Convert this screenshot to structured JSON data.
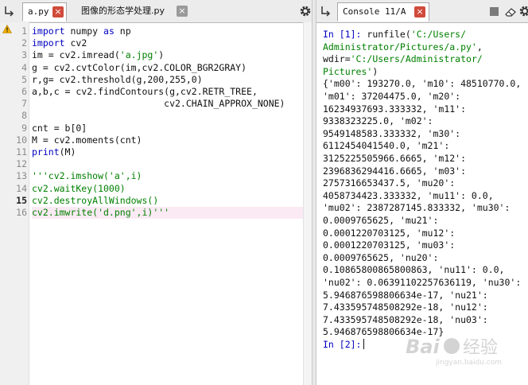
{
  "editor": {
    "tabs": [
      {
        "label": "a.py",
        "close": "×"
      },
      {
        "label": "图像的形态学处理.py",
        "close": "×"
      }
    ],
    "line_numbers": [
      "1",
      "2",
      "3",
      "4",
      "5",
      "6",
      "7",
      "8",
      "9",
      "10",
      "11",
      "12",
      "13",
      "14",
      "15",
      "16"
    ],
    "current_line": 15,
    "code": {
      "l1a": "import",
      "l1b": " numpy ",
      "l1c": "as",
      "l1d": " np",
      "l2a": "import",
      "l2b": " cv2",
      "l3a": "im = cv2.imread(",
      "l3b": "'a.jpg'",
      "l3c": ")",
      "l4": "g = cv2.cvtColor(im,cv2.COLOR_BGR2GRAY)",
      "l5": "r,g= cv2.threshold(g,200,255,0)",
      "l6": "a,b,c = cv2.findContours(g,cv2.RETR_TREE,",
      "l7": "                        cv2.CHAIN_APPROX_NONE)",
      "l9": "cnt = b[0]",
      "l10": "M = cv2.moments(cnt)",
      "l11a": "print",
      "l11b": "(M)",
      "l13": "'''cv2.imshow('a',i)",
      "l14": "cv2.waitKey(1000)",
      "l15": "cv2.destroyAllWindows()",
      "l16": "cv2.imwrite('d.png',i)'''"
    }
  },
  "console": {
    "tab_label": "Console 11/A",
    "close": "×",
    "in1_prompt": "In [1]:",
    "in1_cmd": " runfile(",
    "in1_path1": "'C:/Users/",
    "in1_path2": "Administrator/Pictures/a.py'",
    "in1_sep": ",",
    "in1_wdir_key": "wdir=",
    "in1_wdir1": "'C:/Users/Administrator/",
    "in1_wdir2": "Pictures'",
    "in1_end": ")",
    "output": [
      "{'m00': 193270.0, 'm10': 48510770.0,",
      "'m01': 37204475.0, 'm20':",
      "16234937693.333332, 'm11':",
      "9338323225.0, 'm02':",
      "9549148583.333332, 'm30':",
      "6112454041540.0, 'm21':",
      "3125225505966.6665, 'm12':",
      "2396836294416.6665, 'm03':",
      "2757316653437.5, 'mu20':",
      "4058734423.333332, 'mu11': 0.0,",
      "'mu02': 2387287145.833332, 'mu30':",
      "0.0009765625, 'mu21':",
      "0.0001220703125, 'mu12':",
      "0.0001220703125, 'mu03':",
      "0.0009765625, 'nu20':",
      "0.10865800865800863, 'nu11': 0.0,",
      "'nu02': 0.06391102257636119, 'nu30':",
      "5.946876598806634e-17, 'nu21':",
      "7.433595748508292e-18, 'nu12':",
      "7.433595748508292e-18, 'nu03':",
      "5.946876598806634e-17}"
    ],
    "in2_prompt": "In [2]:"
  },
  "watermark": {
    "text": "Baidu 经验",
    "sub": "jingyan.baidu.com"
  },
  "colors": {
    "keyword": "#0000c0",
    "string": "#008000",
    "close_button": "#d04a3a",
    "highlight_line": "#fbeaf4"
  }
}
